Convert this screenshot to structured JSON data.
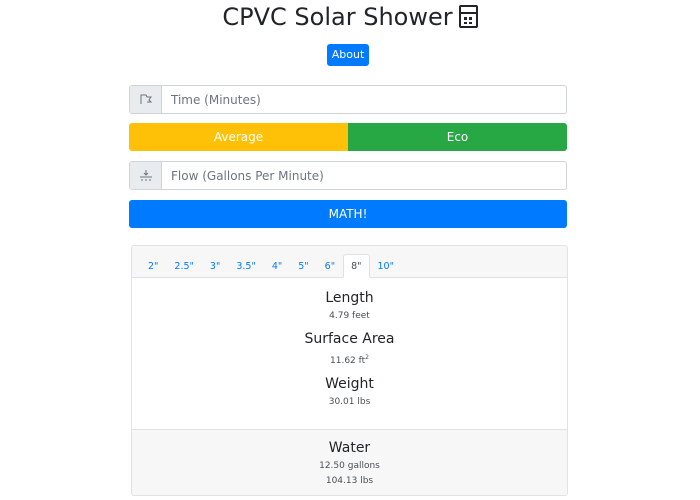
{
  "header": {
    "title": "CPVC Solar Shower",
    "title_icon": "calculator-icon",
    "about_label": "About"
  },
  "form": {
    "time": {
      "icon": "hourglass-flag-icon",
      "placeholder": "Time (Minutes)",
      "value": ""
    },
    "mode": {
      "options": [
        {
          "label": "Average",
          "color": "#ffc107"
        },
        {
          "label": "Eco",
          "color": "#28a745"
        }
      ]
    },
    "flow": {
      "icon": "water-flow-icon",
      "placeholder": "Flow (Gallons Per Minute)",
      "value": ""
    },
    "submit_label": "MATH!",
    "submit_color": "#007bff"
  },
  "results": {
    "tabs": [
      {
        "label": "2\"",
        "active": false
      },
      {
        "label": "2.5\"",
        "active": false
      },
      {
        "label": "3\"",
        "active": false
      },
      {
        "label": "3.5\"",
        "active": false
      },
      {
        "label": "4\"",
        "active": false
      },
      {
        "label": "5\"",
        "active": false
      },
      {
        "label": "6\"",
        "active": false
      },
      {
        "label": "8\"",
        "active": true
      },
      {
        "label": "10\"",
        "active": false
      }
    ],
    "length": {
      "title": "Length",
      "value": "4.79 feet"
    },
    "surface_area": {
      "title": "Surface Area",
      "value": "11.62 ft",
      "unit_sup": "2"
    },
    "weight": {
      "title": "Weight",
      "value": "30.01 lbs"
    },
    "water": {
      "title": "Water",
      "gallons": "12.50 gallons",
      "lbs": "104.13 lbs"
    }
  }
}
